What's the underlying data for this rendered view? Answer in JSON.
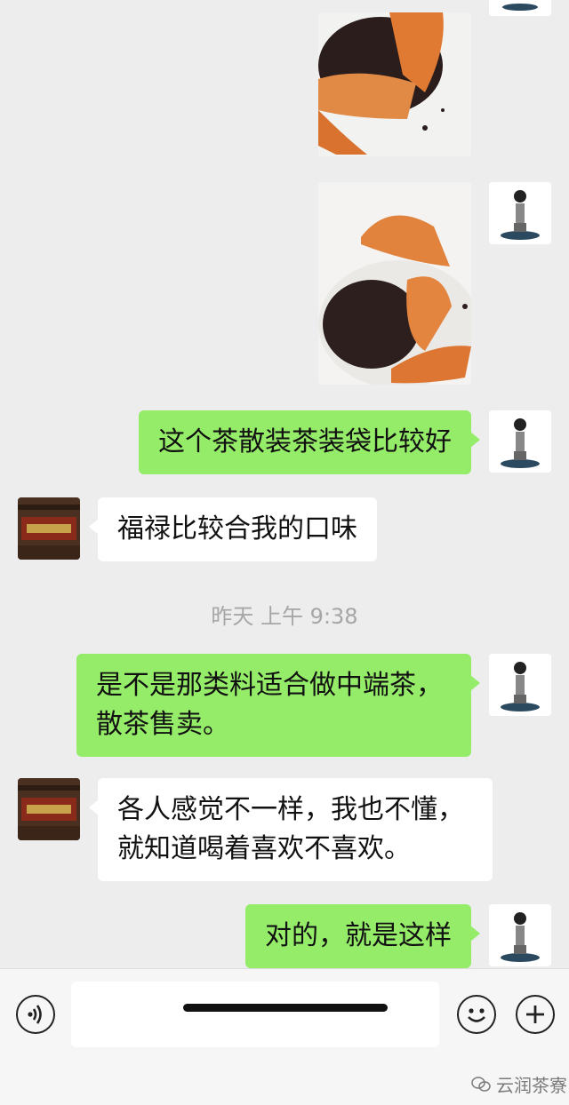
{
  "messages": {
    "m1_text": "这个茶散装茶装袋比较好",
    "m2_text": "福禄比较合我的口味",
    "m3_text": "是不是那类料适合做中端茶，\n散茶售卖。",
    "m4_text": "各人感觉不一样，我也不懂，\n就知道喝着喜欢不喜欢。",
    "m5_text": "对的，就是这样"
  },
  "timestamp": "昨天 上午 9:38",
  "input": {
    "placeholder": ""
  },
  "watermark": "云润茶寮",
  "colors": {
    "bubble_me": "#95ec69",
    "bubble_other": "#ffffff",
    "background": "#ededed"
  },
  "icons": {
    "voice": "voice-icon",
    "emoji": "emoji-icon",
    "plus": "plus-icon"
  }
}
